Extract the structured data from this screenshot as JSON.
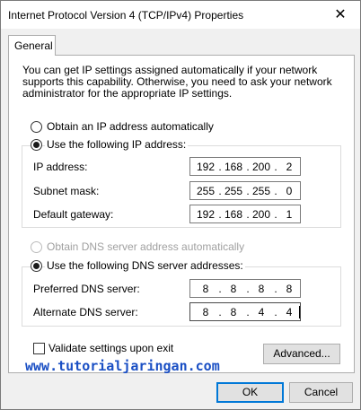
{
  "window": {
    "title": "Internet Protocol Version 4 (TCP/IPv4) Properties",
    "close_symbol": "✕"
  },
  "tabs": [
    {
      "label": "General"
    }
  ],
  "description": "You can get IP settings assigned automatically if your network supports this capability. Otherwise, you need to ask your network administrator for the appropriate IP settings.",
  "ip_section": {
    "auto_label": "Obtain an IP address automatically",
    "auto_selected": false,
    "manual_label": "Use the following IP address:",
    "manual_selected": true,
    "fields": {
      "ip_address": {
        "label": "IP address:",
        "octets": [
          "192",
          "168",
          "200",
          "2"
        ]
      },
      "subnet_mask": {
        "label": "Subnet mask:",
        "octets": [
          "255",
          "255",
          "255",
          "0"
        ]
      },
      "default_gateway": {
        "label": "Default gateway:",
        "octets": [
          "192",
          "168",
          "200",
          "1"
        ]
      }
    }
  },
  "dns_section": {
    "auto_label": "Obtain DNS server address automatically",
    "auto_disabled": true,
    "manual_label": "Use the following DNS server addresses:",
    "manual_selected": true,
    "fields": {
      "preferred": {
        "label": "Preferred DNS server:",
        "octets": [
          "8",
          "8",
          "8",
          "8"
        ]
      },
      "alternate": {
        "label": "Alternate DNS server:",
        "octets": [
          "8",
          "8",
          "4",
          "4"
        ]
      }
    }
  },
  "validate": {
    "label": "Validate settings upon exit",
    "checked": false
  },
  "buttons": {
    "advanced": "Advanced...",
    "ok": "OK",
    "cancel": "Cancel"
  },
  "watermark": "www.tutorialjaringan.com",
  "colors": {
    "watermark": "#1a4fc4",
    "default_button_border": "#0078d7",
    "window_bg": "#f0f0f0"
  }
}
